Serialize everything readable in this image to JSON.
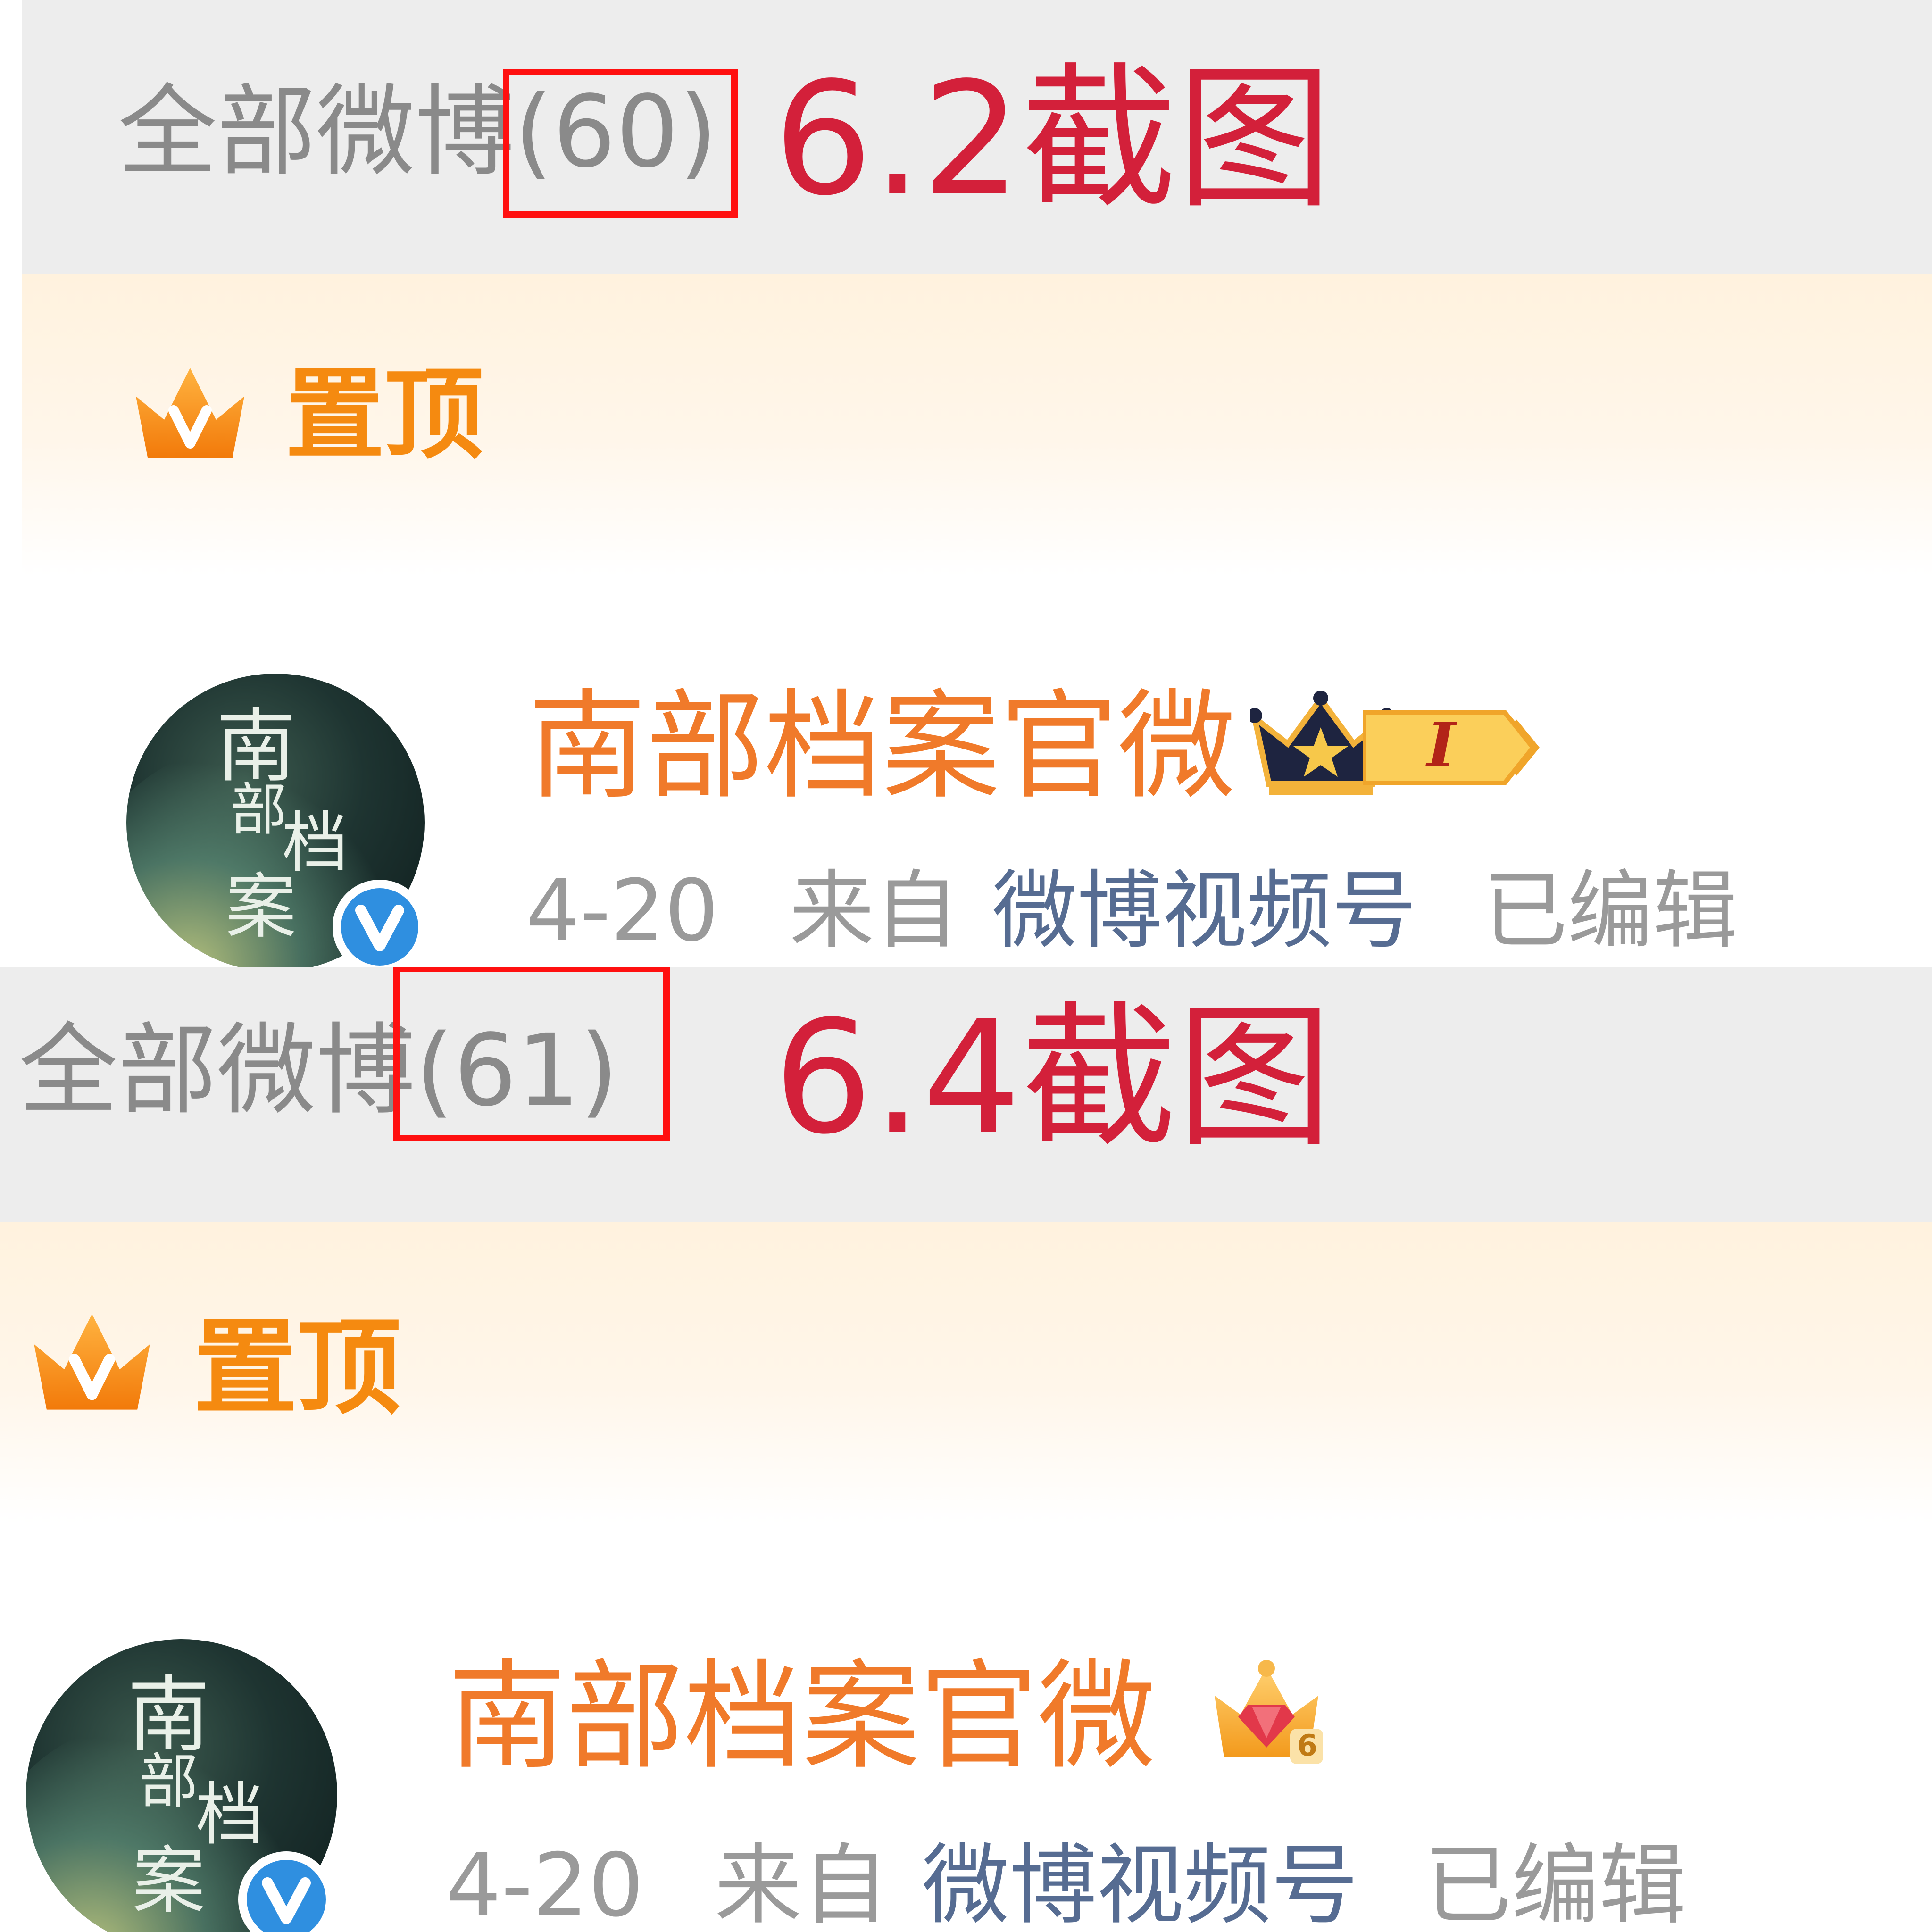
{
  "panels": [
    {
      "header": {
        "count_label": "全部微博(60)",
        "annotation": "6.2截图"
      },
      "pinned": {
        "label": "置顶"
      },
      "post": {
        "username": "南部档案官微",
        "avatar_text": [
          "南",
          "部",
          "档",
          "案"
        ],
        "member_badge_text": "I",
        "date": "4-20",
        "from_label": "来自",
        "source": "微博视频号",
        "edited": "已编辑"
      }
    },
    {
      "header": {
        "count_label": "全部微博(61)",
        "annotation": "6.4截图"
      },
      "pinned": {
        "label": "置顶"
      },
      "post": {
        "username": "南部档案官微",
        "avatar_text": [
          "南",
          "部",
          "档",
          "案"
        ],
        "member_badge_text": "6",
        "date": "4-20",
        "from_label": "来自",
        "source": "微博视频号",
        "edited": "已编辑"
      }
    }
  ],
  "colors": {
    "header_bg": "#ededed",
    "count_text": "#8a8a8a",
    "annotation_red": "#d3203a",
    "highlight_red": "#ff1010",
    "pin_orange": "#f58a10",
    "username_orange": "#f07a2a",
    "source_blue": "#566c92",
    "verified_blue": "#2f8fe0"
  },
  "icons": [
    "crown-v-icon",
    "verified-v-icon",
    "svip-crown-icon",
    "member-level-badge",
    "diamond-crown-icon"
  ]
}
